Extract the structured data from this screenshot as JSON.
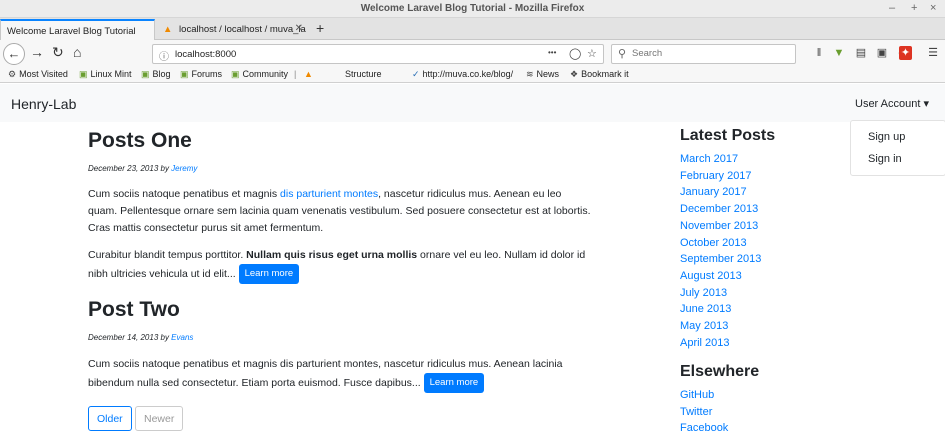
{
  "window": {
    "title": "Welcome Laravel Blog Tutorial - Mozilla Firefox",
    "controls": [
      "–",
      "+",
      "×"
    ]
  },
  "tabs": [
    {
      "label": "Welcome Laravel Blog Tutorial"
    },
    {
      "label": "localhost / localhost / muva_la"
    }
  ],
  "newtab": "+",
  "toolbar": {
    "back": "←",
    "forward": "→",
    "reload": "↻",
    "home": "⌂",
    "url": "localhost:8000",
    "page_actions": "•••",
    "search_placeholder": "Search"
  },
  "bookmarks": [
    "Most Visited",
    "Linux Mint",
    "Blog",
    "Forums",
    "Community",
    "Structure",
    "http://muva.co.ke/blog/",
    "News",
    "Bookmark it"
  ],
  "site": {
    "brand": "Henry-Lab",
    "user_menu": "User Account ▾",
    "dropdown": [
      "Sign up",
      "Sign in"
    ]
  },
  "posts": [
    {
      "title": "Posts One",
      "date": "December 23, 2013 by ",
      "author": "Jeremy",
      "p1_before": "Cum sociis natoque penatibus et magnis ",
      "p1_link": "dis parturient montes",
      "p1_after": ", nascetur ridiculus mus. Aenean eu leo quam. Pellentesque ornare sem lacinia quam venenatis vestibulum. Sed posuere consectetur est at lobortis. Cras mattis consectetur purus sit amet fermentum.",
      "p2_before": "Curabitur blandit tempus porttitor. ",
      "p2_bold": "Nullam quis risus eget urna mollis",
      "p2_after": " ornare vel eu leo. Nullam id dolor id nibh ultricies vehicula ut id elit... ",
      "button": "Learn more"
    },
    {
      "title": "Post Two",
      "date": "December 14, 2013 by ",
      "author": "Evans",
      "p1": "Cum sociis natoque penatibus et magnis dis parturient montes, nascetur ridiculus mus. Aenean lacinia bibendum nulla sed consectetur. Etiam porta euismod. Fusce dapibus... ",
      "button": "Learn more"
    }
  ],
  "pager": {
    "older": "Older",
    "newer": "Newer"
  },
  "sidebar": {
    "latest_heading": "Latest Posts",
    "archives": [
      "March 2017",
      "February 2017",
      "January 2017",
      "December 2013",
      "November 2013",
      "October 2013",
      "September 2013",
      "August 2013",
      "July 2013",
      "June 2013",
      "May 2013",
      "April 2013"
    ],
    "elsewhere_heading": "Elsewhere",
    "elsewhere": [
      "GitHub",
      "Twitter",
      "Facebook"
    ]
  },
  "colors": {
    "link": "#007bff",
    "tab_accent": "#0a84ff",
    "navbar_bg": "#f8f9fa"
  }
}
